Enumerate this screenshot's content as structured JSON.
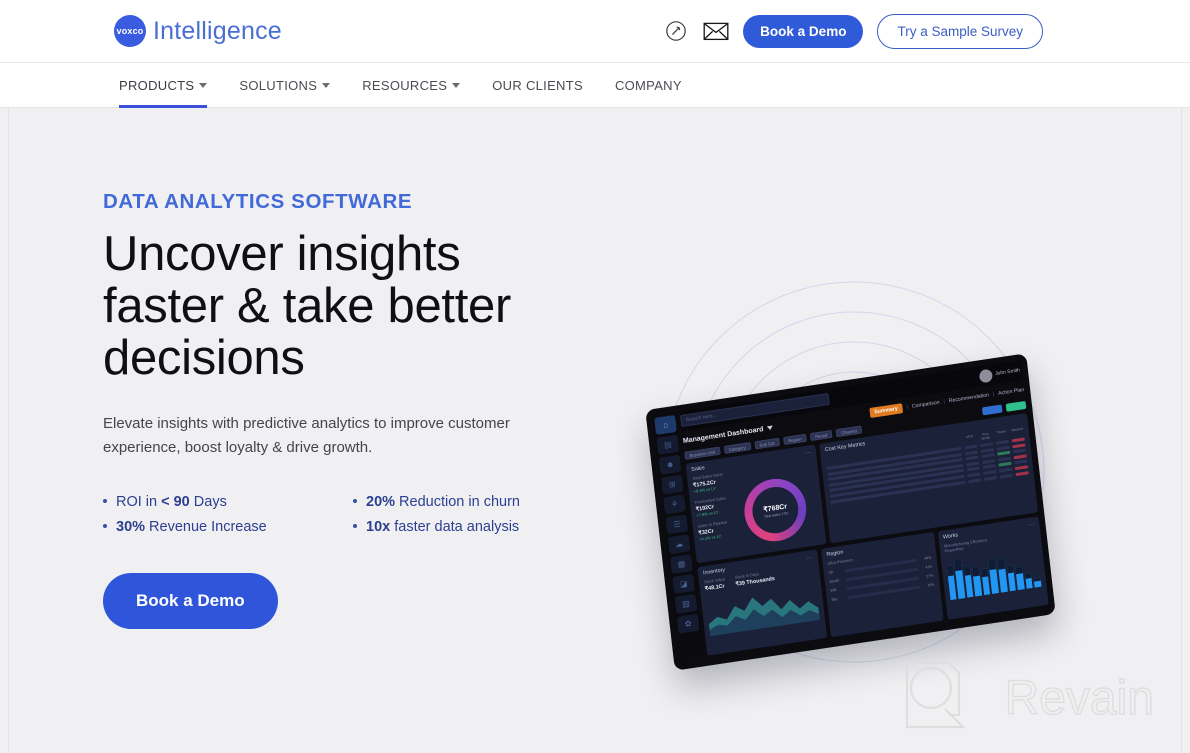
{
  "header": {
    "logo_badge_text": "voxco",
    "logo_text": "Intelligence",
    "phone_icon": "phone-icon",
    "mail_icon": "envelope-icon",
    "book_demo_label": "Book a Demo",
    "sample_survey_label": "Try a Sample Survey"
  },
  "nav": {
    "items": [
      {
        "label": "PRODUCTS",
        "has_caret": true,
        "active": true
      },
      {
        "label": "SOLUTIONS",
        "has_caret": true,
        "active": false
      },
      {
        "label": "RESOURCES",
        "has_caret": true,
        "active": false
      },
      {
        "label": "OUR CLIENTS",
        "has_caret": false,
        "active": false
      },
      {
        "label": "COMPANY",
        "has_caret": false,
        "active": false
      }
    ]
  },
  "hero": {
    "eyebrow": "DATA ANALYTICS SOFTWARE",
    "headline": "Uncover insights faster & take better decisions",
    "subhead": "Elevate insights with predictive analytics to improve customer experience, boost loyalty & drive growth.",
    "bullets": [
      {
        "pre": "ROI in ",
        "strong": "< 90",
        "post": " Days"
      },
      {
        "pre": "",
        "strong": "20%",
        "post": " Reduction in churn"
      },
      {
        "pre": "",
        "strong": "30%",
        "post": " Revenue Increase"
      },
      {
        "pre": "",
        "strong": "10x",
        "post": " faster data analysis"
      }
    ],
    "cta_label": "Book a Demo",
    "accent_blue": "#2f55da",
    "eyebrow_blue": "#4169d8",
    "bullet_blue": "#2c3f91",
    "background": "#f0f0f2"
  },
  "dashboard": {
    "search_placeholder": "Search here...",
    "title": "Management Dashboard",
    "user_name": "John Smith",
    "tabs": [
      {
        "label": "Summary",
        "active": true
      },
      {
        "label": "Comparison",
        "active": false
      },
      {
        "label": "Recommendation",
        "active": false
      },
      {
        "label": "Action Plan",
        "active": false
      }
    ],
    "tab_active_color": "#e07b22",
    "filter_chips": [
      "Business Unit",
      "Category",
      "Sub Cat",
      "Region",
      "Period",
      "Channel"
    ],
    "action_chips": [
      "Apply",
      "Reset"
    ],
    "panels": {
      "sales": {
        "title": "Sales",
        "metrics": [
          {
            "label": "Total Sales Value",
            "value": "₹175.2Cr",
            "delta": "+6.4% vs LY"
          },
          {
            "label": "Forecasted Sales",
            "value": "₹192Cr",
            "delta": "+7.8% vs LY"
          },
          {
            "label": "Sales in Pipeline",
            "value": "₹32Cr",
            "delta": "+4.1% vs LY"
          }
        ],
        "donut_value": "₹768Cr",
        "donut_label": "Total Sales YTD"
      },
      "key_metrics": {
        "title": "Cost Key Metrics",
        "columns": [
          "MTD",
          "Prev Month",
          "Target",
          "Variance"
        ],
        "rows": [
          "Revenue Cost",
          "Operation Cost",
          "Raw Material Cost",
          "Raw Material Price Variance",
          "Cost Realisation Cost",
          "Cost Freight Distribution Cost",
          "Cost Adjusted with Contribution"
        ]
      },
      "inventory": {
        "title": "Inventory",
        "metrics": [
          {
            "label": "Stock Value",
            "value": "₹48.1Cr"
          },
          {
            "label": "Stock in Days",
            "value": "₹39 Thousands"
          }
        ]
      },
      "region": {
        "title": "Region",
        "subtitle": "Ultra Premium",
        "rows": [
          {
            "label": "UP",
            "pct": 48,
            "value": "48%"
          },
          {
            "label": "South",
            "pct": 41,
            "value": "41%"
          },
          {
            "label": "WB",
            "pct": 27,
            "value": "27%"
          },
          {
            "label": "Guj",
            "pct": 16,
            "value": "16%"
          }
        ],
        "bar_color": "#d98023"
      },
      "works": {
        "title": "Works",
        "subtitle": "Manufacturing Efficiency",
        "legend": "PowerPlan",
        "bar_color": "#2196f3",
        "values": [
          78,
          92,
          72,
          66,
          61,
          80,
          76,
          58,
          52,
          34,
          22
        ]
      }
    },
    "rail_icons": [
      "home-icon",
      "dashboard-icon",
      "users-icon",
      "grid-icon",
      "analytics-icon",
      "report-icon",
      "cloud-icon",
      "calendar-icon",
      "chart-icon",
      "folder-icon",
      "settings-icon"
    ]
  },
  "watermark": {
    "text": "Revain",
    "logo_icon": "revain-logo-icon"
  }
}
